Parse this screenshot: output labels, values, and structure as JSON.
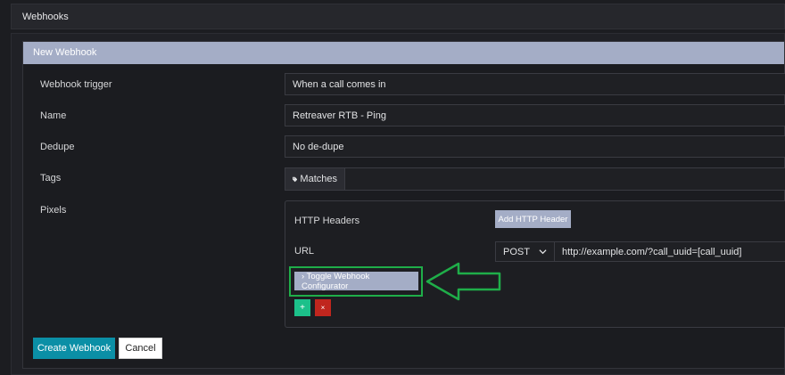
{
  "page": {
    "title": "Webhooks"
  },
  "card": {
    "title": "New Webhook"
  },
  "form": {
    "trigger_label": "Webhook trigger",
    "trigger_value": "When a call comes in",
    "name_label": "Name",
    "name_value": "Retreaver RTB - Ping",
    "dedupe_label": "Dedupe",
    "dedupe_value": "No de-dupe",
    "tags_label": "Tags",
    "tags_chip": "Matches",
    "pixels_label": "Pixels"
  },
  "pixel": {
    "http_headers_label": "HTTP Headers",
    "add_header_button": "Add HTTP Header",
    "url_label": "URL",
    "method": "POST",
    "url_value": "http://example.com/?call_uuid=[call_uuid]",
    "toggle_button": "› Toggle Webhook Configurator",
    "add_button": "+",
    "remove_button": "×"
  },
  "actions": {
    "create": "Create Webhook",
    "cancel": "Cancel"
  },
  "colors": {
    "accent": "#a4adc6",
    "primary": "#0b8fa6",
    "success": "#1cc08a",
    "danger": "#c0261e",
    "highlight": "#1fae49"
  },
  "icons": {
    "tag": "tag-icon",
    "chevron": "chevron-down-icon",
    "arrow": "left-arrow-annotation"
  }
}
